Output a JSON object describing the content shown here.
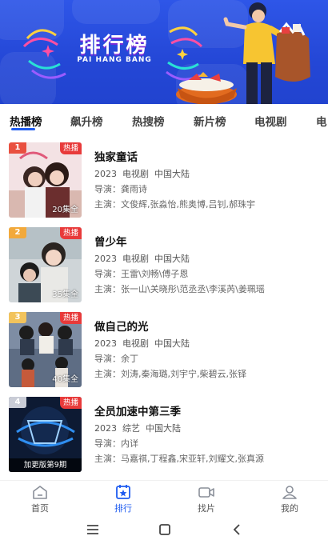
{
  "banner": {
    "title": "排行榜",
    "subtitle": "PAI HANG BANG"
  },
  "tabs": [
    {
      "label": "热播榜",
      "active": true
    },
    {
      "label": "飙升榜",
      "active": false
    },
    {
      "label": "热搜榜",
      "active": false
    },
    {
      "label": "新片榜",
      "active": false
    },
    {
      "label": "电视剧",
      "active": false
    },
    {
      "label": "电",
      "active": false
    }
  ],
  "list": [
    {
      "rank": "1",
      "badge": "热播",
      "episodes": "20集全",
      "title": "独家童话",
      "year": "2023",
      "category": "电视剧",
      "region": "中国大陆",
      "director_label": "导演：",
      "director": "龚雨诗",
      "cast_label": "主演：",
      "cast": "文俊辉,张淼怡,熊奥博,吕钊,郝珠宇"
    },
    {
      "rank": "2",
      "badge": "热播",
      "episodes": "35集全",
      "title": "曾少年",
      "year": "2023",
      "category": "电视剧",
      "region": "中国大陆",
      "director_label": "导演：",
      "director": "王雷\\刘畅\\傅子恩",
      "cast_label": "主演：",
      "cast": "张一山\\关晓彤\\范丞丞\\李溪芮\\姜珮瑶"
    },
    {
      "rank": "3",
      "badge": "热播",
      "episodes": "40集全",
      "title": "做自己的光",
      "year": "2023",
      "category": "电视剧",
      "region": "中国大陆",
      "director_label": "导演：",
      "director": "余丁",
      "cast_label": "主演：",
      "cast": "刘涛,秦海璐,刘宇宁,柴碧云,张铎"
    },
    {
      "rank": "4",
      "badge": "热播",
      "episodes": "加更版第9期",
      "title": "全员加速中第三季",
      "year": "2023",
      "category": "综艺",
      "region": "中国大陆",
      "director_label": "导演：",
      "director": "内详",
      "cast_label": "主演：",
      "cast": "马嘉祺,丁程鑫,宋亚轩,刘耀文,张真源"
    }
  ],
  "bottom_nav": [
    {
      "label": "首页",
      "icon": "home-icon",
      "active": false
    },
    {
      "label": "排行",
      "icon": "ranking-icon",
      "active": true
    },
    {
      "label": "找片",
      "icon": "video-camera-icon",
      "active": false
    },
    {
      "label": "我的",
      "icon": "user-icon",
      "active": false
    }
  ],
  "colors": {
    "accent": "#1f5cf0",
    "banner": "#2447d6",
    "hot_badge": "#e83a3a"
  }
}
